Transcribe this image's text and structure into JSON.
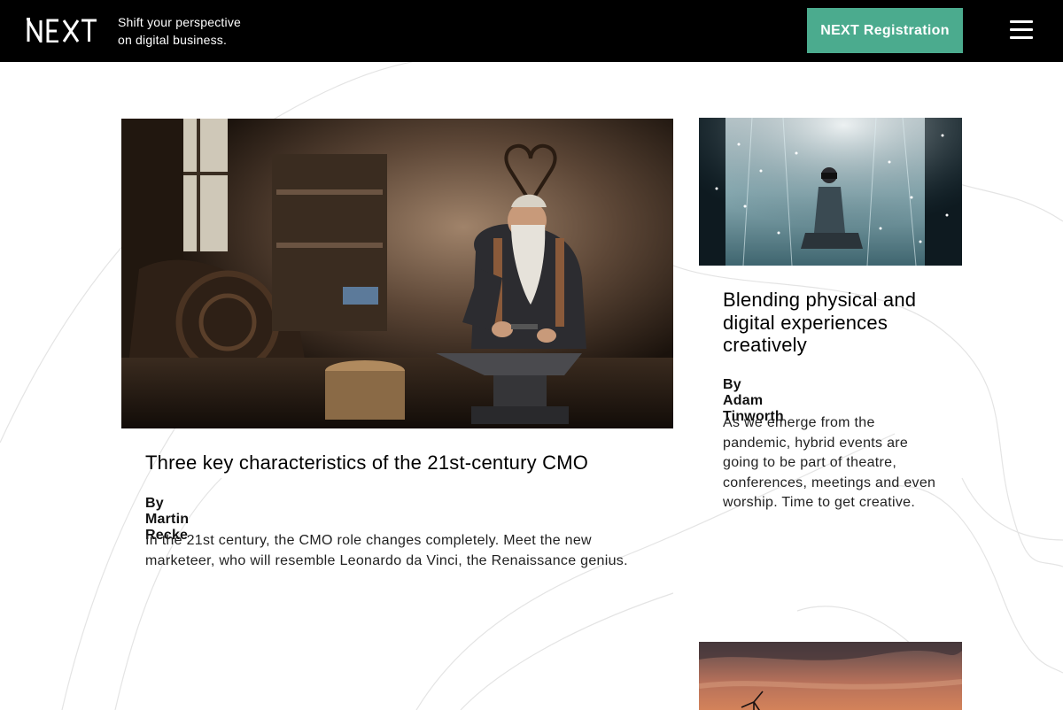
{
  "header": {
    "logo_text": "NEXT",
    "tagline_line1": "Shift your perspective",
    "tagline_line2": "on digital business.",
    "registration_label": "NEXT Registration",
    "menu_icon": "hamburger-menu-icon"
  },
  "articles": [
    {
      "title": "Three key characteristics of the 21st-century CMO",
      "author": "By Martin Recke",
      "excerpt": "In the 21st century, the CMO role changes completely. Meet the new marketeer, who will resemble Leonardo da Vinci, the Renaissance genius."
    },
    {
      "title": "Blending physical and digital experiences creatively",
      "author": "By Adam Tinworth",
      "excerpt": "As we emerge from the pandemic, hybrid events are going to be part of theatre, conferences, meetings and even worship. Time to get creative."
    }
  ],
  "colors": {
    "header_bg": "#000000",
    "accent": "#4bab8e",
    "text": "#111111"
  }
}
